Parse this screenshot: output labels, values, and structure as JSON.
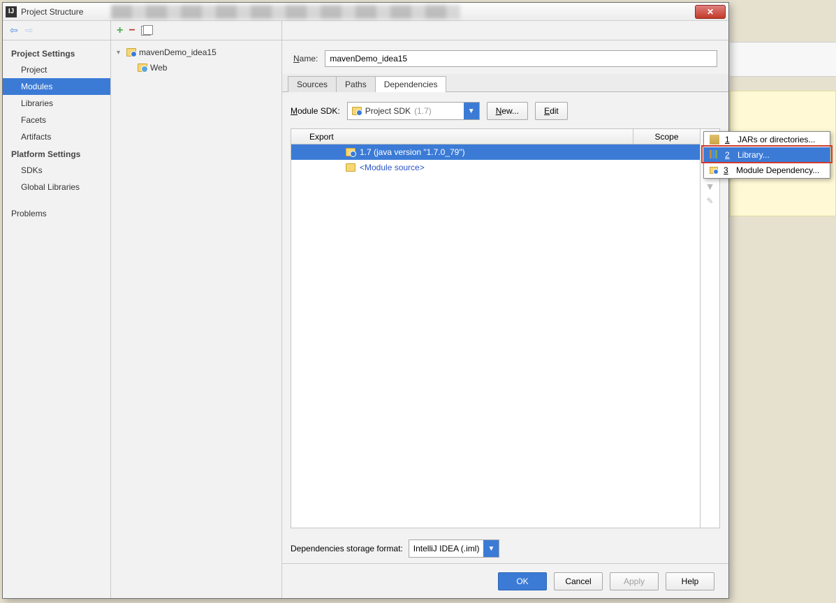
{
  "window": {
    "title": "Project Structure"
  },
  "sidebar": {
    "headings": {
      "project": "Project Settings",
      "platform": "Platform Settings"
    },
    "projectItems": [
      "Project",
      "Modules",
      "Libraries",
      "Facets",
      "Artifacts"
    ],
    "platformItems": [
      "SDKs",
      "Global Libraries"
    ],
    "problems": "Problems",
    "selected": "Modules"
  },
  "tree": {
    "module": "mavenDemo_idea15",
    "child": "Web"
  },
  "main": {
    "nameLabel": "Name:",
    "nameValue": "mavenDemo_idea15",
    "tabs": [
      "Sources",
      "Paths",
      "Dependencies"
    ],
    "activeTab": "Dependencies",
    "sdkLabel": "Module SDK:",
    "sdkName": "Project SDK",
    "sdkVersion": "(1.7)",
    "newBtn": "New...",
    "editBtn": "Edit",
    "cols": {
      "export": "Export",
      "scope": "Scope"
    },
    "rows": [
      {
        "text": "1.7 (java version \"1.7.0_79\")",
        "selected": true,
        "src": false
      },
      {
        "text": "<Module source>",
        "selected": false,
        "src": true
      }
    ],
    "storageLabel": "Dependencies storage format:",
    "storageValue": "IntelliJ IDEA (.iml)"
  },
  "popup": {
    "items": [
      {
        "num": "1",
        "label": "JARs or directories..."
      },
      {
        "num": "2",
        "label": "Library...",
        "selected": true
      },
      {
        "num": "3",
        "label": "Module Dependency..."
      }
    ]
  },
  "buttons": {
    "ok": "OK",
    "cancel": "Cancel",
    "apply": "Apply",
    "help": "Help"
  }
}
